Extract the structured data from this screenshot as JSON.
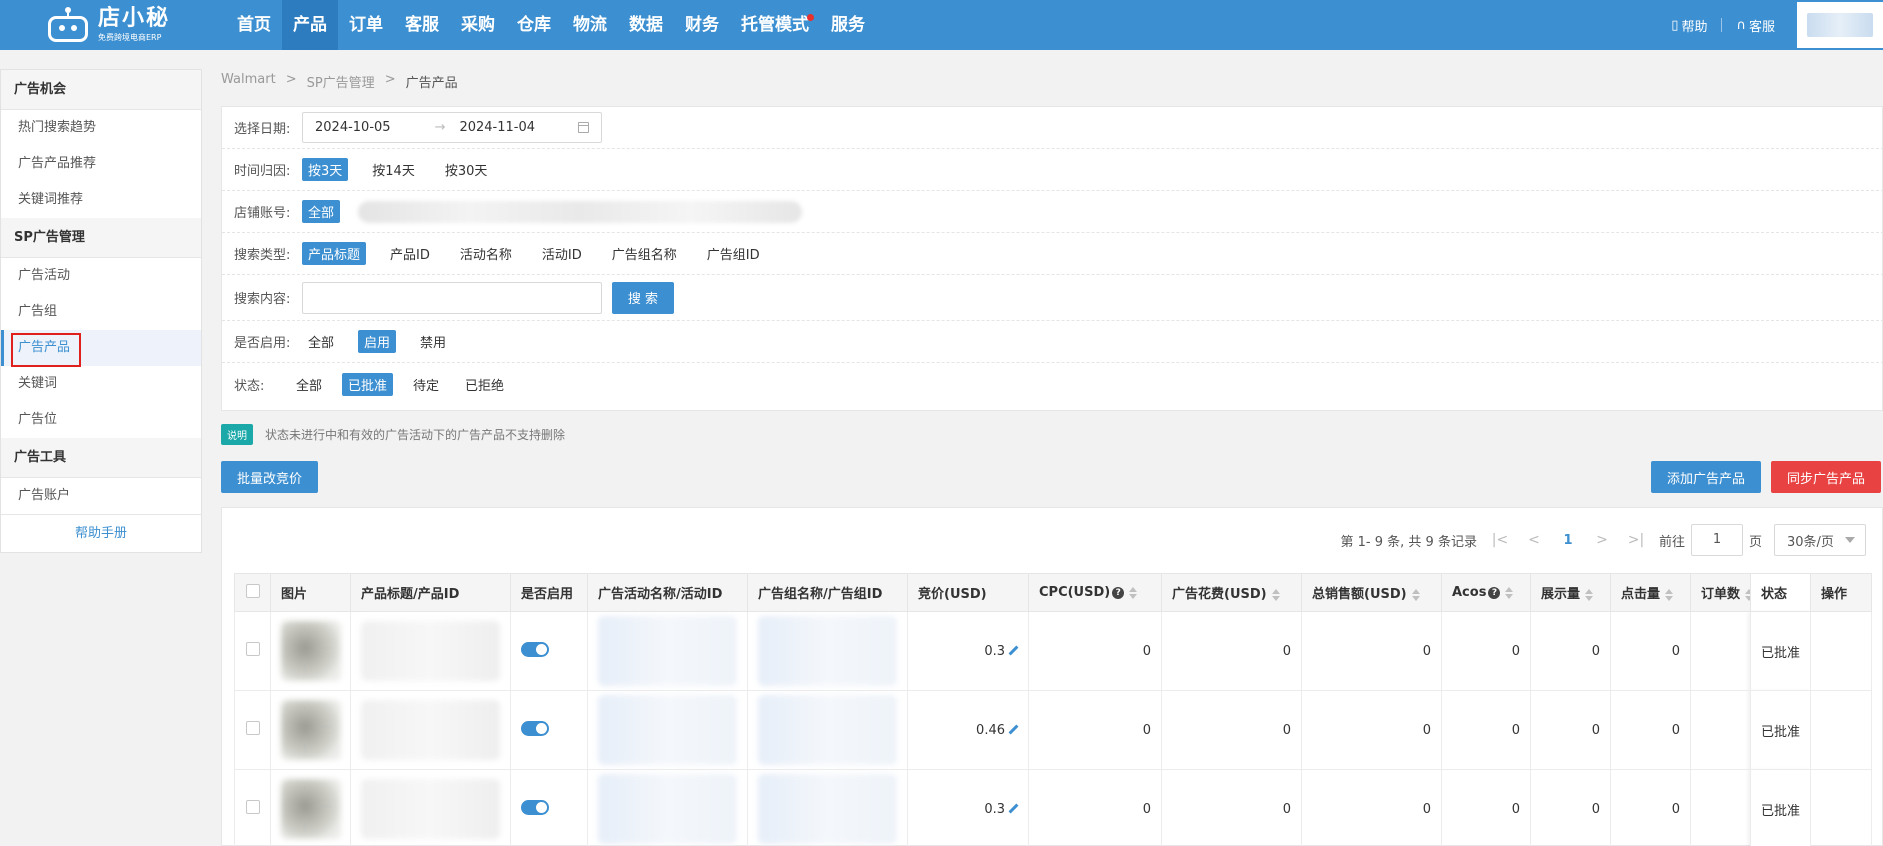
{
  "brand": {
    "title": "店小秘",
    "subtitle": "免费跨境电商ERP"
  },
  "nav": {
    "items": [
      "首页",
      "产品",
      "订单",
      "客服",
      "采购",
      "仓库",
      "物流",
      "数据",
      "财务",
      "托管模式",
      "服务"
    ],
    "active": "产品"
  },
  "top_right": {
    "help": "帮助",
    "service": "客服"
  },
  "sidebar": {
    "group1": "广告机会",
    "group1_items": [
      "热门搜索趋势",
      "广告产品推荐",
      "关键词推荐"
    ],
    "group2": "SP广告管理",
    "group2_items": [
      "广告活动",
      "广告组",
      "广告产品",
      "关键词",
      "广告位"
    ],
    "group3": "广告工具",
    "group3_items": [
      "广告账户"
    ],
    "help": "帮助手册"
  },
  "breadcrumb": {
    "a": "Walmart",
    "sep": ">",
    "b": "SP广告管理",
    "c": "广告产品"
  },
  "filters": {
    "date_label": "选择日期:",
    "date_start": "2024-10-05",
    "date_arrow": "→",
    "date_end": "2024-11-04",
    "attr_label": "时间归因:",
    "attr_opts": [
      "按3天",
      "按14天",
      "按30天"
    ],
    "shop_label": "店铺账号:",
    "shop_all": "全部",
    "type_label": "搜索类型:",
    "type_opts": [
      "产品标题",
      "产品ID",
      "活动名称",
      "活动ID",
      "广告组名称",
      "广告组ID"
    ],
    "content_label": "搜索内容:",
    "search_btn": "搜 索",
    "enabled_label": "是否启用:",
    "enabled_opts": [
      "全部",
      "启用",
      "禁用"
    ],
    "status_label": "状态:",
    "status_opts": [
      "全部",
      "已批准",
      "待定",
      "已拒绝"
    ]
  },
  "notice": {
    "tag": "说明",
    "text": "状态未进行中和有效的广告活动下的广告产品不支持删除"
  },
  "actions": {
    "bulk_bid": "批量改竞价",
    "add": "添加广告产品",
    "sync": "同步广告产品"
  },
  "pager": {
    "summary": "第 1- 9 条, 共 9 条记录",
    "first": "|<",
    "prev": "<",
    "page": "1",
    "next": ">",
    "last": ">|",
    "goto_label": "前往",
    "goto_value": "1",
    "page_unit": "页",
    "size": "30条/页"
  },
  "table": {
    "headers": [
      "图片",
      "产品标题/产品ID",
      "是否启用",
      "广告活动名称/活动ID",
      "广告组名称/广告组ID",
      "竞价(USD)",
      "CPC(USD)",
      "广告花费(USD)",
      "总销售额(USD)",
      "Acos",
      "展示量",
      "点击量",
      "订单数",
      "状态",
      "操作"
    ],
    "rows": [
      {
        "bid": "0.3",
        "cpc": "0",
        "spend": "0",
        "sales": "0",
        "acos": "0",
        "impr": "0",
        "clicks": "0",
        "status": "已批准"
      },
      {
        "bid": "0.46",
        "cpc": "0",
        "spend": "0",
        "sales": "0",
        "acos": "0",
        "impr": "0",
        "clicks": "0",
        "status": "已批准"
      },
      {
        "bid": "0.3",
        "cpc": "0",
        "spend": "0",
        "sales": "0",
        "acos": "0",
        "impr": "0",
        "clicks": "0",
        "status": "已批准"
      }
    ]
  },
  "colors": {
    "primary": "#3c8fd0",
    "danger": "#e94242",
    "teal": "#1aa8a8"
  }
}
